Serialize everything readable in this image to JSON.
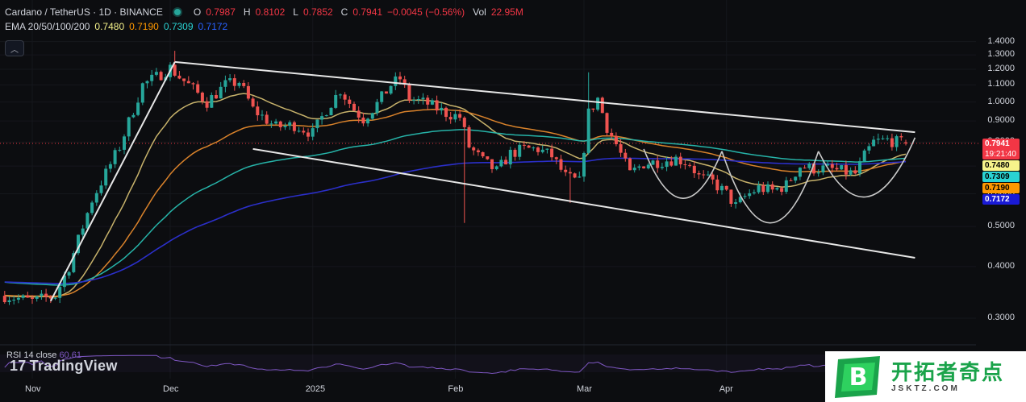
{
  "header": {
    "symbol": "Cardano / TetherUS · 1D · BINANCE",
    "open_label": "O",
    "open": "0.7987",
    "high_label": "H",
    "high": "0.8102",
    "low_label": "L",
    "low": "0.7852",
    "close_label": "C",
    "close": "0.7941",
    "change": "−0.0045 (−0.56%)",
    "vol_label": "Vol",
    "vol": "22.95M"
  },
  "ema_legend": {
    "label": "EMA 20/50/100/200",
    "v20": "0.7480",
    "v50": "0.7190",
    "v100": "0.7309",
    "v200": "0.7172"
  },
  "rsi_legend": {
    "label": "RSI 14 close",
    "value": "60.61"
  },
  "logo": {
    "brand": "TradingView"
  },
  "watermark": {
    "title": "开拓者奇点",
    "url": "JSKTZ.COM",
    "badge": "B"
  },
  "colors": {
    "up": "#26a69a",
    "down": "#ef5350",
    "ema20": "#c7b26b",
    "ema50": "#d9822b",
    "ema100": "#26b3a8",
    "ema200": "#2b2fc9",
    "channel": "#e6e6e6",
    "rsi": "#7e57c2"
  },
  "price_tags": [
    {
      "text": "0.7941",
      "sub": "19:21:40",
      "bg": "#f23645",
      "fg": "#ffffff",
      "price": 0.7941
    },
    {
      "text": "0.7480",
      "bg": "#f7f48b",
      "fg": "#000000",
      "price": 0.748
    },
    {
      "text": "0.7309",
      "bg": "#2ad3d3",
      "fg": "#000000",
      "price": 0.7309
    },
    {
      "text": "0.7190",
      "bg": "#ff9800",
      "fg": "#000000",
      "price": 0.719
    },
    {
      "text": "0.7172",
      "bg": "#1a1ad6",
      "fg": "#ffffff",
      "price": 0.7172
    }
  ],
  "chart_data": {
    "type": "candlestick",
    "y_axis": {
      "scale": "log",
      "ticks": [
        0.3,
        0.4,
        0.5,
        0.6,
        0.7,
        0.8,
        0.9,
        1.0,
        1.1,
        1.2,
        1.3,
        1.4
      ],
      "tick_labels": [
        "0.3000",
        "0.4000",
        "0.5000",
        "0.6000",
        "0.7000",
        "0.8000",
        "0.9000",
        "1.0000",
        "1.1000",
        "1.2000",
        "1.3000",
        "1.4000"
      ]
    },
    "x_axis": {
      "ticks": [
        {
          "label": "Nov",
          "day": 0
        },
        {
          "label": "Dec",
          "day": 30
        },
        {
          "label": "2025",
          "day": 61
        },
        {
          "label": "Feb",
          "day": 92
        },
        {
          "label": "Mar",
          "day": 120
        },
        {
          "label": "Apr",
          "day": 151
        }
      ]
    },
    "close_anchors": [
      [
        -6,
        0.34
      ],
      [
        0,
        0.33
      ],
      [
        5,
        0.34
      ],
      [
        8,
        0.4
      ],
      [
        13,
        0.58
      ],
      [
        19,
        0.78
      ],
      [
        24,
        1.1
      ],
      [
        27,
        1.15
      ],
      [
        30,
        1.21
      ],
      [
        32,
        1.15
      ],
      [
        34,
        1.1
      ],
      [
        38,
        1.0
      ],
      [
        42,
        1.1
      ],
      [
        45,
        1.12
      ],
      [
        48,
        0.96
      ],
      [
        53,
        0.87
      ],
      [
        57,
        0.88
      ],
      [
        61,
        0.84
      ],
      [
        64,
        0.96
      ],
      [
        67,
        1.07
      ],
      [
        70,
        0.96
      ],
      [
        72,
        0.91
      ],
      [
        75,
        0.99
      ],
      [
        78,
        1.1
      ],
      [
        80,
        1.14
      ],
      [
        82,
        1.02
      ],
      [
        86,
        0.99
      ],
      [
        90,
        0.94
      ],
      [
        93,
        0.92
      ],
      [
        95,
        0.78
      ],
      [
        98,
        0.72
      ],
      [
        101,
        0.68
      ],
      [
        104,
        0.75
      ],
      [
        107,
        0.77
      ],
      [
        110,
        0.77
      ],
      [
        113,
        0.74
      ],
      [
        116,
        0.66
      ],
      [
        119,
        0.64
      ],
      [
        121,
        0.94
      ],
      [
        123,
        1.02
      ],
      [
        125,
        0.87
      ],
      [
        127,
        0.79
      ],
      [
        130,
        0.67
      ],
      [
        133,
        0.71
      ],
      [
        137,
        0.72
      ],
      [
        140,
        0.73
      ],
      [
        143,
        0.71
      ],
      [
        145,
        0.66
      ],
      [
        148,
        0.64
      ],
      [
        151,
        0.6
      ],
      [
        153,
        0.56
      ],
      [
        155,
        0.59
      ],
      [
        158,
        0.62
      ],
      [
        161,
        0.61
      ],
      [
        164,
        0.63
      ],
      [
        167,
        0.7
      ],
      [
        170,
        0.69
      ],
      [
        173,
        0.69
      ],
      [
        176,
        0.68
      ],
      [
        179,
        0.67
      ],
      [
        181,
        0.74
      ],
      [
        183,
        0.8
      ],
      [
        186,
        0.81
      ],
      [
        188,
        0.8
      ],
      [
        190,
        0.7941
      ]
    ],
    "wick_events": [
      {
        "day": 31,
        "high": 1.33
      },
      {
        "day": 94,
        "low": 0.51
      },
      {
        "day": 121,
        "high": 1.18
      },
      {
        "day": 117,
        "low": 0.57
      }
    ],
    "emas": [
      {
        "name": "EMA 20",
        "last": 0.748
      },
      {
        "name": "EMA 50",
        "last": 0.719
      },
      {
        "name": "EMA 100",
        "last": 0.7309
      },
      {
        "name": "EMA 200",
        "last": 0.7172
      }
    ],
    "annotations": {
      "upper_channel": [
        [
          31,
          1.25
        ],
        [
          192,
          0.845
        ]
      ],
      "lower_channel": [
        [
          48,
          0.77
        ],
        [
          192,
          0.42
        ]
      ],
      "rally_line": [
        [
          4,
          0.33
        ],
        [
          31,
          1.25
        ]
      ],
      "cup_pattern": [
        {
          "from": [
            133,
            0.77
          ],
          "to": [
            150,
            0.76
          ],
          "bottom": 0.585
        },
        {
          "from": [
            150,
            0.76
          ],
          "to": [
            171,
            0.76
          ],
          "bottom": 0.51
        },
        {
          "from": [
            171,
            0.76
          ],
          "to": [
            192,
            0.82
          ],
          "bottom": 0.59
        }
      ]
    },
    "rsi_last": 60.61
  }
}
